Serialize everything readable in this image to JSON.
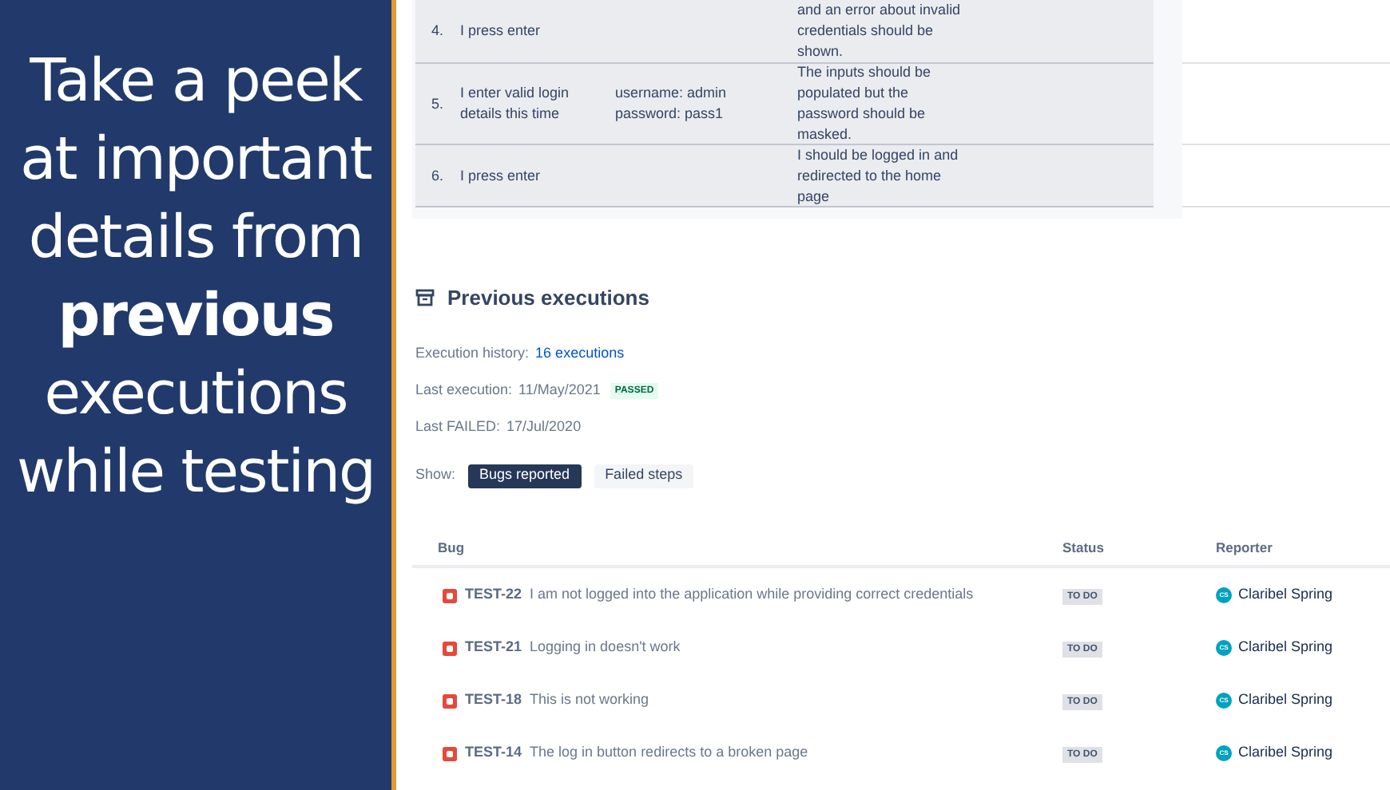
{
  "banner": {
    "text": "Take a peek at important details from **previous** executions while testing"
  },
  "steps": [
    {
      "number": "4.",
      "step": "I press enter",
      "expected": "and an error about invalid credentials should be shown."
    },
    {
      "number": "5.",
      "step": "I enter valid login details this time",
      "data": "username: admin password: pass1",
      "expected": "The inputs should be populated but the password should be masked."
    },
    {
      "number": "6.",
      "step": "I press enter",
      "expected": "I should be logged in and redirected to the home page"
    }
  ],
  "previous_executions": {
    "title": "Previous executions",
    "history_label": "Execution history:",
    "history_link": "16 executions",
    "last_execution_label": "Last execution:",
    "last_execution_date": "11/May/2021",
    "last_execution_status": "PASSED",
    "last_failed_label": "Last FAILED:",
    "last_failed_date": "17/Jul/2020",
    "show_label": "Show:",
    "filters": [
      {
        "label": "Bugs reported",
        "selected": true
      },
      {
        "label": "Failed steps",
        "selected": false
      }
    ]
  },
  "bugs": {
    "columns": [
      "Bug",
      "Status",
      "Reporter"
    ],
    "rows": [
      {
        "key": "TEST-22",
        "summary": "I am not logged into the application while providing correct credentials",
        "status": "TO DO",
        "reporter": "Claribel Spring",
        "initials": "CS"
      },
      {
        "key": "TEST-21",
        "summary": "Logging in doesn't work",
        "status": "TO DO",
        "reporter": "Claribel Spring",
        "initials": "CS"
      },
      {
        "key": "TEST-18",
        "summary": "This is not working",
        "status": "TO DO",
        "reporter": "Claribel Spring",
        "initials": "CS"
      },
      {
        "key": "TEST-14",
        "summary": "The log in button redirects to a broken page",
        "status": "TO DO",
        "reporter": "Claribel Spring",
        "initials": "CS"
      }
    ]
  }
}
